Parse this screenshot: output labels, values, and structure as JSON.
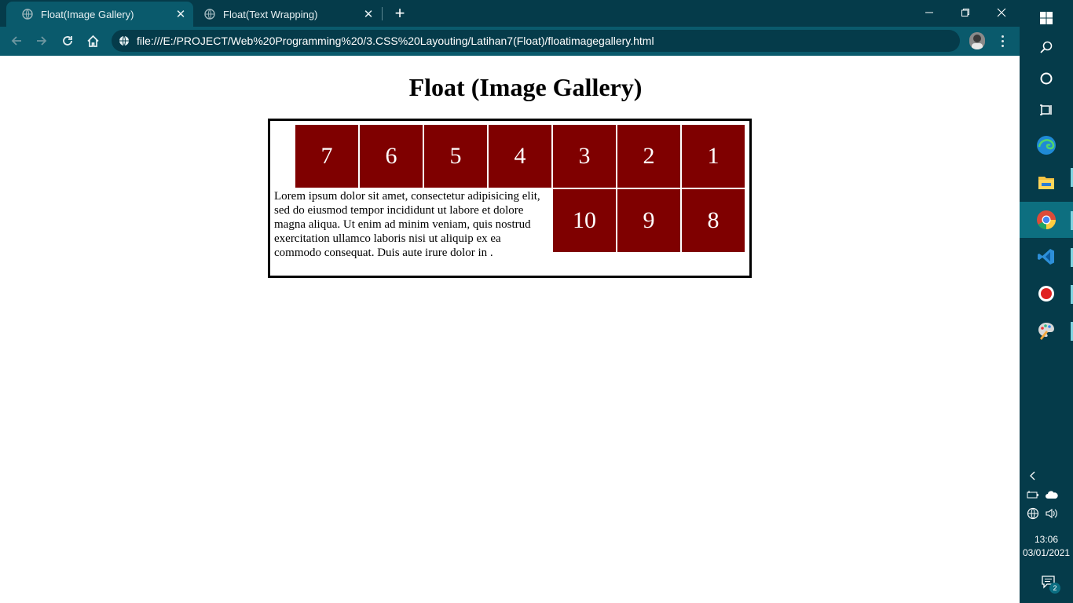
{
  "browser": {
    "tabs": [
      {
        "title": "Float(Image Gallery)",
        "active": true
      },
      {
        "title": "Float(Text Wrapping)",
        "active": false
      }
    ],
    "address": "file:///E:/PROJECT/Web%20Programming%20/3.CSS%20Layouting/Latihan7(Float)/floatimagegallery.html",
    "icons": {
      "back": "arrow-left-icon",
      "forward": "arrow-right-icon",
      "reload": "reload-icon",
      "home": "home-icon",
      "info": "globe-icon",
      "new_tab": "plus-icon",
      "menu": "kebab-menu-icon"
    }
  },
  "page": {
    "title": "Float (Image Gallery)",
    "tiles_row1": [
      "7",
      "6",
      "5",
      "4",
      "3",
      "2",
      "1"
    ],
    "tiles_row2": [
      "10",
      "9",
      "8"
    ],
    "paragraph": "Lorem ipsum dolor sit amet, consectetur adipisicing elit, sed do eiusmod tempor incididunt ut labore et dolore magna aliqua. Ut enim ad minim veniam, quis nostrud exercitation ullamco laboris nisi ut aliquip ex ea commodo consequat. Duis aute irure dolor in .",
    "colors": {
      "tile": "#7f0000",
      "tile_text": "#ffffff",
      "border": "#000000"
    }
  },
  "taskbar": {
    "apps": [
      "windows-start-icon",
      "search-icon",
      "cortana-icon",
      "task-view-icon",
      "edge-icon",
      "file-explorer-icon",
      "chrome-icon",
      "vscode-icon",
      "screen-recorder-icon",
      "paint-icon"
    ],
    "time": "13:06",
    "date": "03/01/2021",
    "notification_count": "2",
    "colors": {
      "background": "#053b4a",
      "active": "#0d6f80"
    }
  }
}
